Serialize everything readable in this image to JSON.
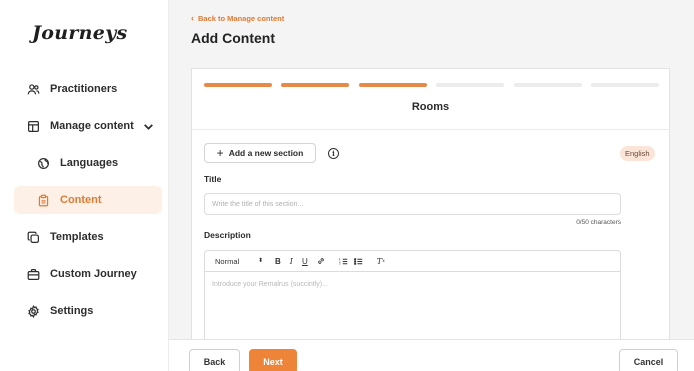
{
  "app": {
    "logo": "Journeys"
  },
  "sidebar": {
    "items": [
      {
        "label": "Practitioners",
        "icon": "users-icon"
      },
      {
        "label": "Manage content",
        "icon": "layout-icon",
        "expanded": true
      },
      {
        "label": "Languages",
        "icon": "globe-icon"
      },
      {
        "label": "Content",
        "icon": "clipboard-icon",
        "active": true
      },
      {
        "label": "Templates",
        "icon": "copy-icon"
      },
      {
        "label": "Custom Journey",
        "icon": "briefcase-icon"
      },
      {
        "label": "Settings",
        "icon": "gear-icon"
      }
    ]
  },
  "header": {
    "back_link": "Back to Manage content",
    "title": "Add Content"
  },
  "stepper": {
    "total_steps": 6,
    "completed_steps": 3,
    "current_step_title": "Rooms"
  },
  "section": {
    "add_button": "Add a new section",
    "language_badge": "English",
    "title_label": "Title",
    "title_placeholder": "Write the title of this section...",
    "title_counter": "0/50 characters",
    "description_label": "Description",
    "editor": {
      "format_select": "Normal",
      "bold": "B",
      "italic": "I",
      "underline": "U",
      "placeholder": "Introduce your Remalrus (succintly)..."
    }
  },
  "footer": {
    "back_label": "Back",
    "next_label": "Next",
    "cancel_label": "Cancel"
  },
  "colors": {
    "accent": "#ee8438",
    "accent_light": "#fdf1e7",
    "badge_bg": "#fbe5d8"
  }
}
